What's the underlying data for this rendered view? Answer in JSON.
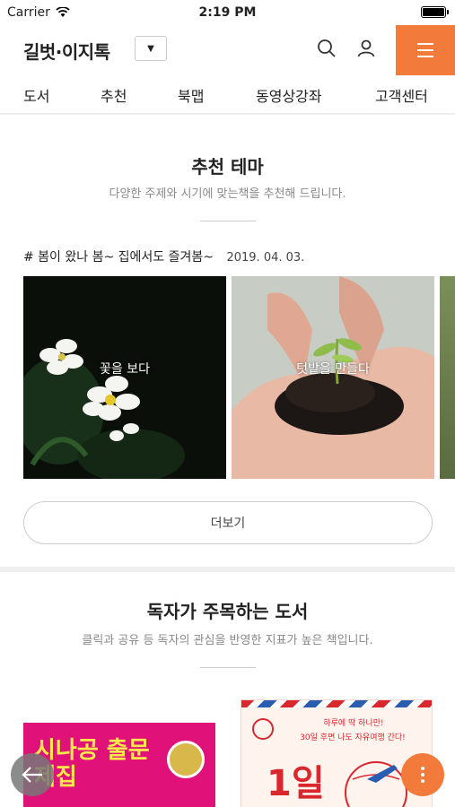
{
  "status_bar": {
    "carrier": "Carrier",
    "time": "2:19 PM"
  },
  "header": {
    "logo": "길벗·이지톡",
    "dropdown_icon": "caret-down-icon"
  },
  "nav": {
    "tabs": [
      "도서",
      "추천",
      "북맵",
      "동영상강좌",
      "고객센터"
    ]
  },
  "recommend": {
    "title": "추천 테마",
    "subtitle": "다양한 주제와 시기에 맞는책을 추천해 드립니다.",
    "theme_title": "# 봄이 왔나 봄~ 집에서도 즐겨봄~",
    "theme_date": "2019. 04. 03.",
    "cards": [
      {
        "label": "꽃을 보다"
      },
      {
        "label": "텃밭을 만들다"
      }
    ],
    "more_button": "더보기"
  },
  "featured": {
    "title": "독자가 주목하는 도서",
    "subtitle": "클릭과 공유 등 독자의 관심을 반영한 지표가 높은 책입니다.",
    "books": [
      {
        "cover_text": "시나공 출문제집",
        "badge": ""
      },
      {
        "cover_small": "하루에 딱 하나만!",
        "cover_sub": "30일 후면 나도 자유여행 간다!",
        "cover_big": "1일"
      }
    ]
  },
  "colors": {
    "accent": "#f27a3a",
    "pink": "#e0127a"
  }
}
